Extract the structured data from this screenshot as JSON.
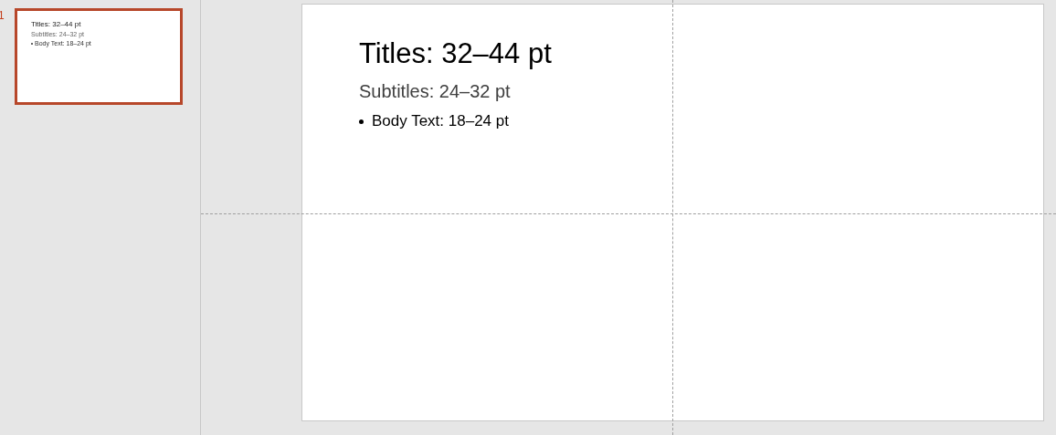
{
  "slide_panel": {
    "slides": [
      {
        "number": "1",
        "selected": true,
        "title": "Titles: 32–44 pt",
        "subtitle": "Subtitles: 24–32 pt",
        "bullets": [
          "Body Text: 18–24 pt"
        ]
      }
    ]
  },
  "slide": {
    "title": "Titles: 32–44 pt",
    "subtitle": "Subtitles: 24–32 pt",
    "bullets": [
      "Body Text: 18–24 pt"
    ]
  }
}
